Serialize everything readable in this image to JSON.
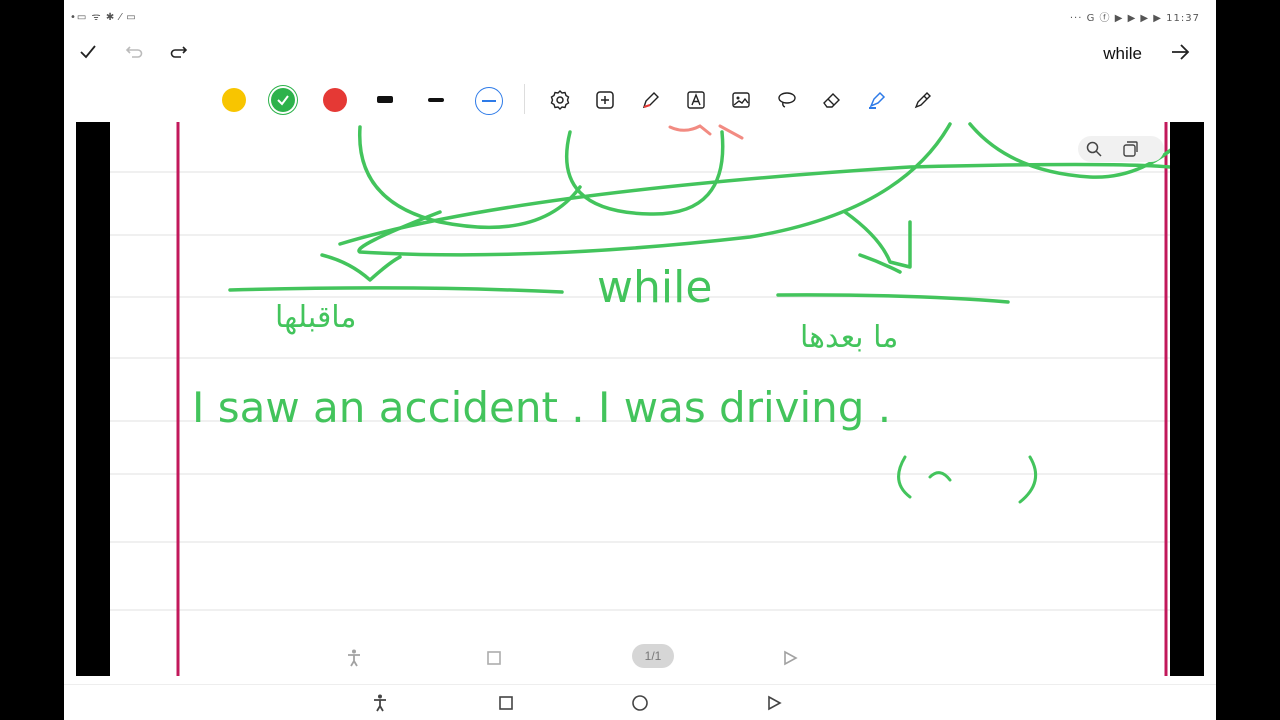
{
  "status_bar": {
    "left": "•▭ ᯤ ✱ ⁄ ▭",
    "right": "··· G ⓕ ▶ ▶ ▶ ▶ 11:37"
  },
  "header": {
    "title": "while",
    "icons": [
      "check-icon",
      "undo-icon",
      "redo-icon",
      "arrow-right-icon"
    ]
  },
  "toolbar": {
    "colors": [
      {
        "name": "yellow",
        "hex": "#F8C500"
      },
      {
        "name": "green",
        "hex": "#2DB24B",
        "selected": true
      },
      {
        "name": "red",
        "hex": "#E53935"
      }
    ],
    "stroke_widths": [
      "thick",
      "medium",
      "thin"
    ],
    "tools": [
      "settings-icon",
      "add-icon",
      "pen-icon",
      "text-icon",
      "image-icon",
      "lasso-icon",
      "eraser-icon",
      "highlighter-icon",
      "marker-icon"
    ]
  },
  "canvas": {
    "ink_color": "#43C45C",
    "page_number": "1/1",
    "handwriting": [
      {
        "text": "while"
      },
      {
        "text": "ماقبلها"
      },
      {
        "text": "ما بعدها"
      },
      {
        "text": "I saw an accident . I was driving ."
      }
    ]
  },
  "nav": {
    "buttons": [
      "accessibility-icon",
      "square-icon",
      "circle-icon",
      "triangle-icon"
    ]
  }
}
